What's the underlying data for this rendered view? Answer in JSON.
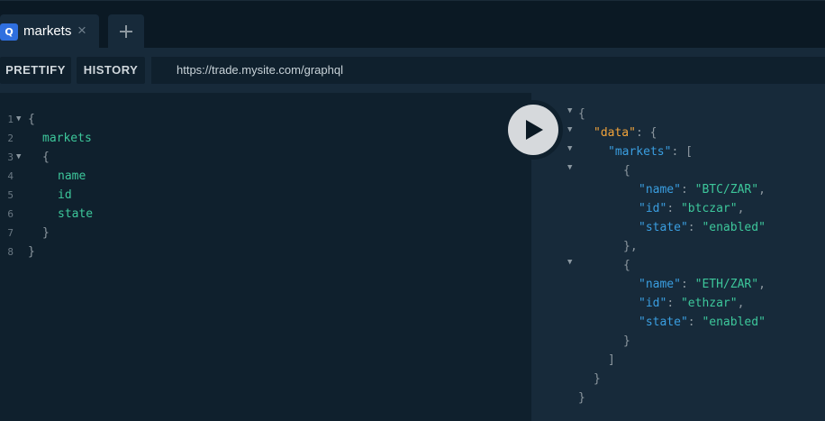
{
  "tabs": [
    {
      "badge": "Q",
      "label": "markets",
      "close_glyph": "×"
    }
  ],
  "add_tab": {
    "icon": "plus-icon"
  },
  "toolbar": {
    "prettify_label": "PRETTIFY",
    "history_label": "HISTORY",
    "endpoint_url": "https://trade.mysite.com/graphql"
  },
  "query": {
    "lines": [
      {
        "num": "1",
        "text": "{"
      },
      {
        "num": "2",
        "text": "markets"
      },
      {
        "num": "3",
        "text": "{"
      },
      {
        "num": "4",
        "text": "name"
      },
      {
        "num": "5",
        "text": "id"
      },
      {
        "num": "6",
        "text": "state"
      },
      {
        "num": "7",
        "text": "}"
      },
      {
        "num": "8",
        "text": "}"
      }
    ]
  },
  "execute": {
    "icon": "play-icon"
  },
  "result": {
    "data_key": "\"data\"",
    "markets_key": "\"markets\"",
    "items": [
      {
        "name_key": "\"name\"",
        "name_val": "\"BTC/ZAR\"",
        "id_key": "\"id\"",
        "id_val": "\"btczar\"",
        "state_key": "\"state\"",
        "state_val": "\"enabled\""
      },
      {
        "name_key": "\"name\"",
        "name_val": "\"ETH/ZAR\"",
        "id_key": "\"id\"",
        "id_val": "\"ethzar\"",
        "state_key": "\"state\"",
        "state_val": "\"enabled\""
      }
    ]
  },
  "colors": {
    "background": "#0f202d",
    "panel": "#172a3a",
    "field_name": "#3dc79b",
    "json_key": "#3a9ee0",
    "data_key": "#f1a33a",
    "badge": "#2f6fdf"
  }
}
